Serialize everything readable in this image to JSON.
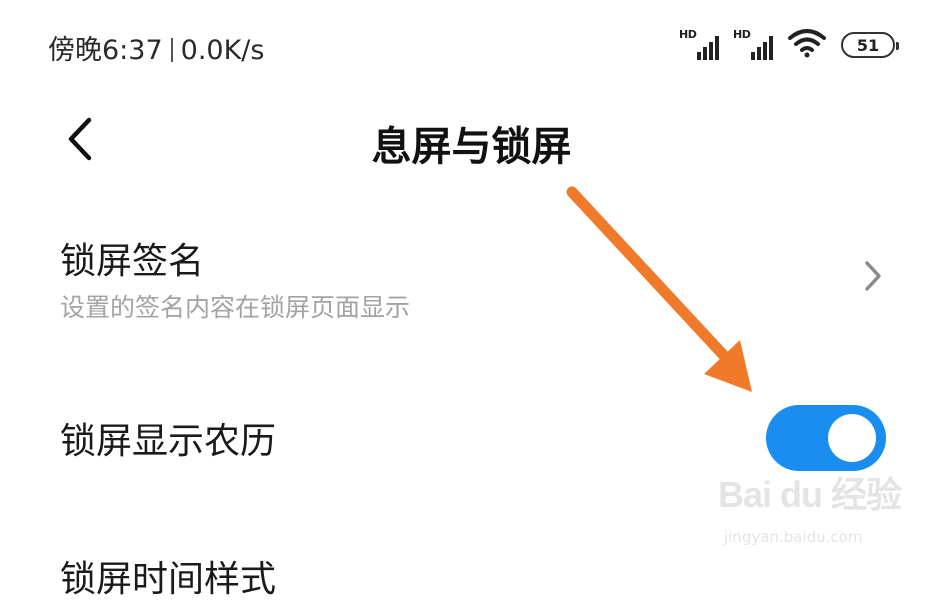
{
  "status_bar": {
    "time": "傍晚6:37",
    "net_speed": "0.0K/s",
    "sim1_label": "HD",
    "sim2_label": "HD",
    "battery_level": "51"
  },
  "header": {
    "title": "息屏与锁屏"
  },
  "settings": [
    {
      "title": "锁屏签名",
      "subtitle": "设置的签名内容在锁屏页面显示",
      "control": "chevron"
    },
    {
      "title": "锁屏显示农历",
      "control": "toggle",
      "toggle_on": true
    },
    {
      "title": "锁屏时间样式"
    }
  ],
  "colors": {
    "toggle_on": "#1a8df0",
    "annotation_arrow": "#f07a2a",
    "subtitle_text": "#a3a3a3"
  },
  "watermark": {
    "brand": "Bai du 经验",
    "url": "jingyan.baidu.com"
  }
}
